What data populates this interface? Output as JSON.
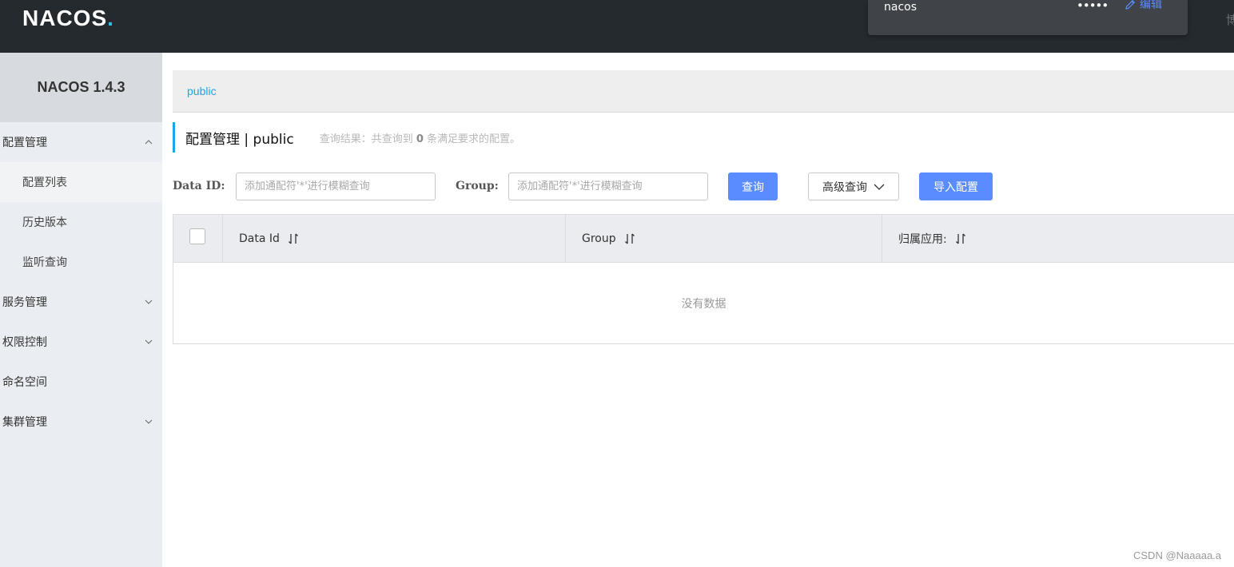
{
  "header": {
    "logo_text": "NACOS",
    "user_popup": {
      "username": "nacos",
      "password_mask": "•••••",
      "edit_label": "编辑"
    },
    "right_text": "博"
  },
  "sidebar": {
    "version_title": "NACOS 1.4.3",
    "items": [
      {
        "label": "配置管理",
        "expanded": true
      },
      {
        "label": "配置列表"
      },
      {
        "label": "历史版本"
      },
      {
        "label": "监听查询"
      },
      {
        "label": "服务管理",
        "expanded": false
      },
      {
        "label": "权限控制",
        "expanded": false
      },
      {
        "label": "命名空间"
      },
      {
        "label": "集群管理",
        "expanded": false
      }
    ]
  },
  "breadcrumb": {
    "namespace": "public"
  },
  "page": {
    "title": "配置管理 | public",
    "result_prefix": "查询结果：共查询到",
    "result_count": "0",
    "result_suffix": "条满足要求的配置。"
  },
  "filters": {
    "data_id_label": "Data ID:",
    "data_id_placeholder": "添加通配符'*'进行模糊查询",
    "group_label": "Group:",
    "group_placeholder": "添加通配符'*'进行模糊查询",
    "search_button": "查询",
    "advanced_button": "高级查询",
    "import_button": "导入配置"
  },
  "table": {
    "columns": [
      "Data Id",
      "Group",
      "归属应用:"
    ],
    "empty_text": "没有数据"
  },
  "watermark": "CSDN @Naaaaa.a",
  "colors": {
    "topbar": "#252a2f",
    "accent": "#5b8cff",
    "link": "#1ea7e2"
  }
}
